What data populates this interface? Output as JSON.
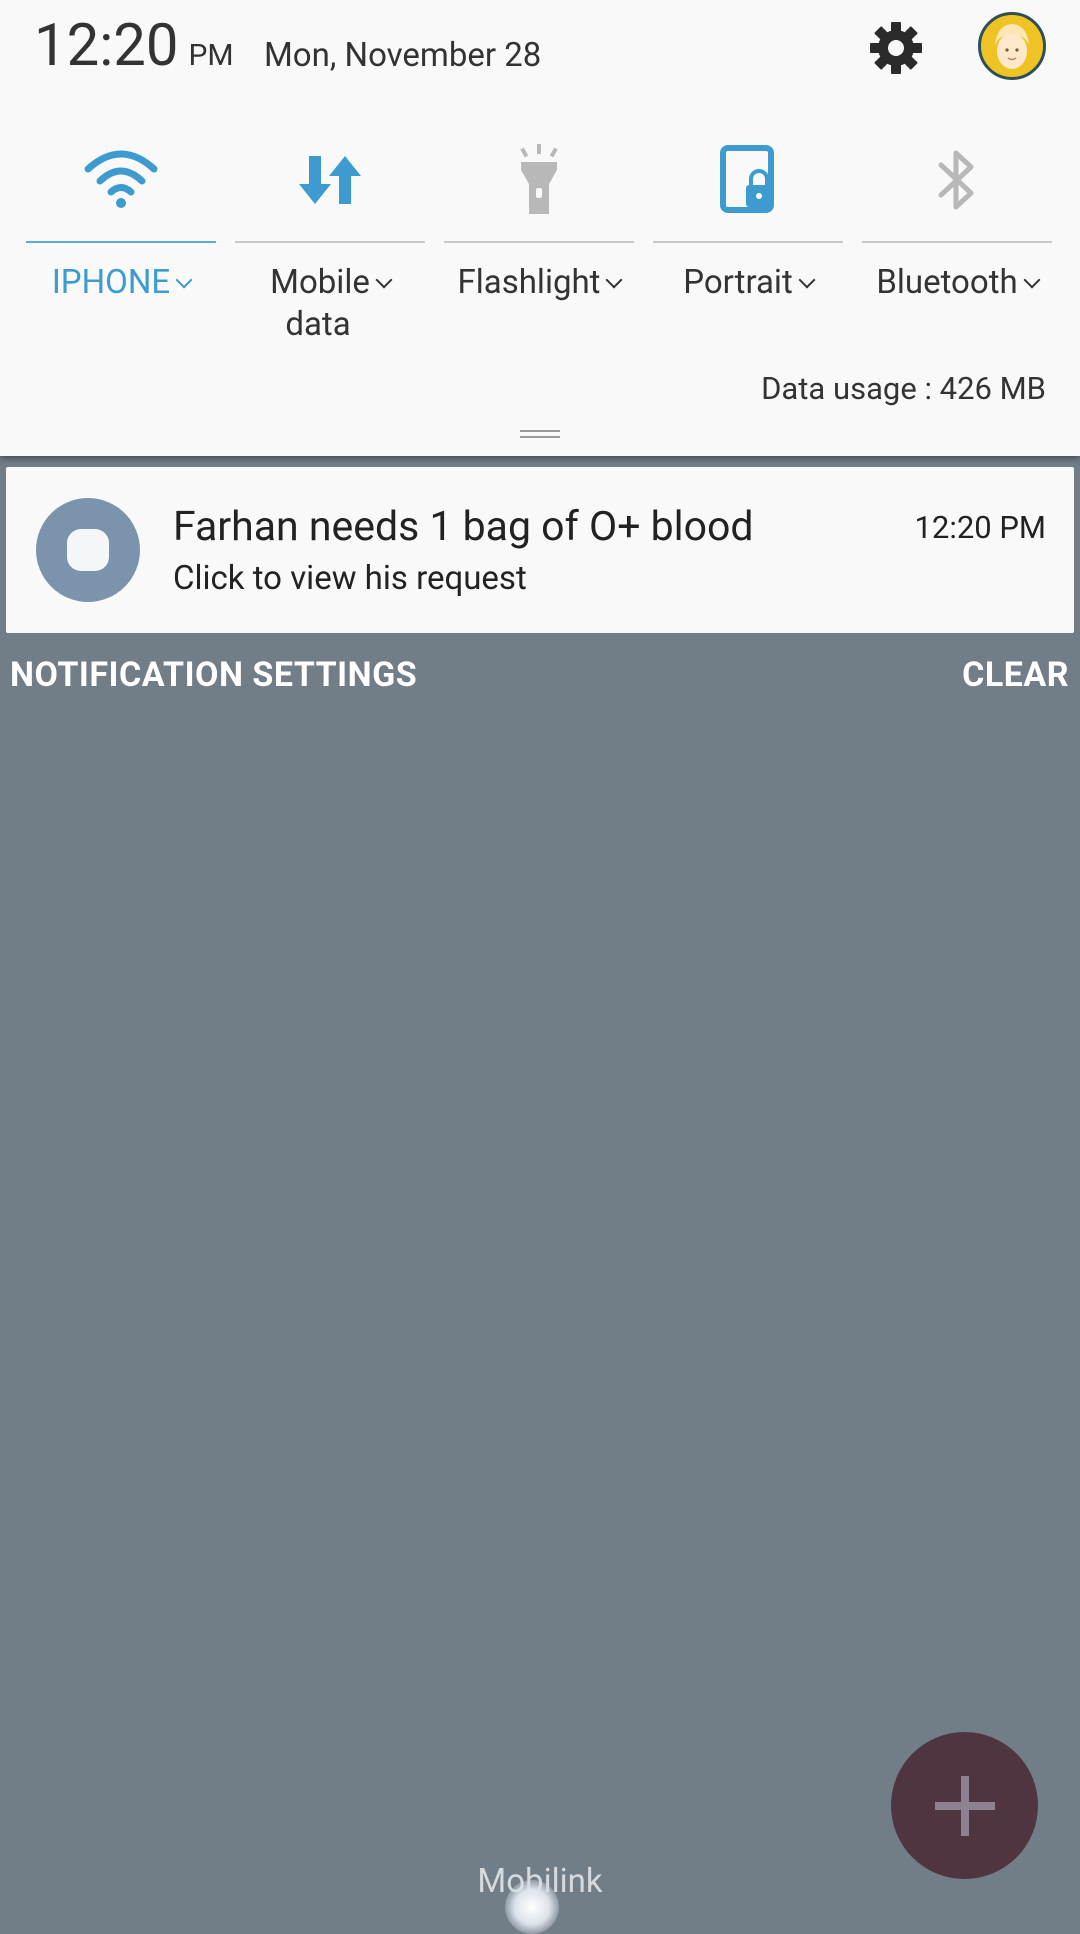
{
  "status": {
    "time": "12:20",
    "ampm": "PM",
    "date": "Mon, November 28"
  },
  "quick_settings": {
    "tiles": [
      {
        "label": "IPHONE",
        "icon": "wifi-icon",
        "active": true
      },
      {
        "label": "Mobile\ndata",
        "icon": "mobile-data-icon",
        "active": false
      },
      {
        "label": "Flashlight",
        "icon": "flashlight-icon",
        "active": false
      },
      {
        "label": "Portrait",
        "icon": "portrait-lock-icon",
        "active": false
      },
      {
        "label": "Bluetooth",
        "icon": "bluetooth-icon",
        "active": false
      }
    ],
    "data_usage": "Data usage : 426 MB"
  },
  "notification": {
    "title": "Farhan needs 1 bag of O+ blood",
    "text": "Click to view his request",
    "time": "12:20 PM"
  },
  "actions": {
    "notification_settings": "NOTIFICATION SETTINGS",
    "clear": "CLEAR"
  },
  "footer": {
    "carrier": "Mobilink"
  },
  "colors": {
    "accent": "#3d9bd0",
    "panel": "#f9f9f9",
    "backdrop": "#717d87",
    "fab": "#4e3540"
  }
}
